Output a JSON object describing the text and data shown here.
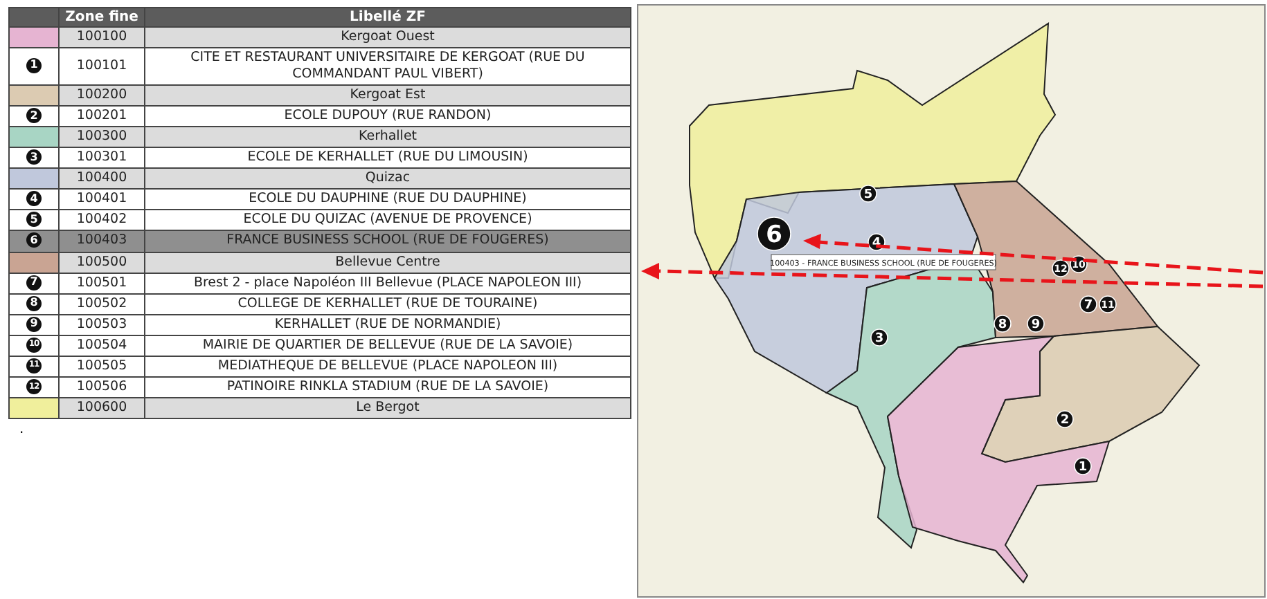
{
  "table": {
    "columns": [
      "Zone fine",
      "Libellé ZF"
    ],
    "rows": [
      {
        "kind": "zone",
        "color": "#e6b4d2",
        "code": "100100",
        "label": "Kergoat Ouest",
        "selected": false
      },
      {
        "kind": "site",
        "marker": "1",
        "code": "100101",
        "label": "CITE ET RESTAURANT UNIVERSITAIRE DE KERGOAT (RUE DU COMMANDANT PAUL VIBERT)",
        "selected": false
      },
      {
        "kind": "zone",
        "color": "#dccbb2",
        "code": "100200",
        "label": "Kergoat Est",
        "selected": false
      },
      {
        "kind": "site",
        "marker": "2",
        "code": "100201",
        "label": "ECOLE DUPOUY (RUE RANDON)",
        "selected": false
      },
      {
        "kind": "zone",
        "color": "#a8d5c4",
        "code": "100300",
        "label": "Kerhallet",
        "selected": false
      },
      {
        "kind": "site",
        "marker": "3",
        "code": "100301",
        "label": "ECOLE DE KERHALLET (RUE DU LIMOUSIN)",
        "selected": false
      },
      {
        "kind": "zone",
        "color": "#c0c8dc",
        "code": "100400",
        "label": "Quizac",
        "selected": false
      },
      {
        "kind": "site",
        "marker": "4",
        "code": "100401",
        "label": "ECOLE DU DAUPHINE (RUE DU DAUPHINE)",
        "selected": false
      },
      {
        "kind": "site",
        "marker": "5",
        "code": "100402",
        "label": "ECOLE DU QUIZAC (AVENUE DE PROVENCE)",
        "selected": false
      },
      {
        "kind": "site",
        "marker": "6",
        "code": "100403",
        "label": "FRANCE BUSINESS SCHOOL (RUE DE FOUGERES)",
        "selected": true
      },
      {
        "kind": "zone",
        "color": "#c9a493",
        "code": "100500",
        "label": "Bellevue Centre",
        "selected": false
      },
      {
        "kind": "site",
        "marker": "7",
        "code": "100501",
        "label": "Brest 2 - place Napoléon III Bellevue (PLACE NAPOLEON III)",
        "selected": false
      },
      {
        "kind": "site",
        "marker": "8",
        "code": "100502",
        "label": "COLLEGE DE KERHALLET (RUE DE TOURAINE)",
        "selected": false
      },
      {
        "kind": "site",
        "marker": "9",
        "code": "100503",
        "label": "KERHALLET (RUE DE NORMANDIE)",
        "selected": false
      },
      {
        "kind": "site",
        "marker": "10",
        "code": "100504",
        "label": "MAIRIE DE QUARTIER DE BELLEVUE (RUE DE LA SAVOIE)",
        "selected": false
      },
      {
        "kind": "site",
        "marker": "11",
        "code": "100505",
        "label": "MEDIATHEQUE DE BELLEVUE (PLACE NAPOLEON III)",
        "selected": false
      },
      {
        "kind": "site",
        "marker": "12",
        "code": "100506",
        "label": "PATINOIRE RINKLA STADIUM (RUE DE LA SAVOIE)",
        "selected": false
      },
      {
        "kind": "zone",
        "color": "#f0ef9c",
        "code": "100600",
        "label": "Le Bergot",
        "selected": false
      }
    ]
  },
  "note": ".",
  "map": {
    "markers": [
      {
        "label": "1",
        "selected": false
      },
      {
        "label": "2",
        "selected": false
      },
      {
        "label": "3",
        "selected": false
      },
      {
        "label": "4",
        "selected": false
      },
      {
        "label": "5",
        "selected": false
      },
      {
        "label": "6",
        "selected": true
      },
      {
        "label": "7",
        "selected": false
      },
      {
        "label": "8",
        "selected": false
      },
      {
        "label": "9",
        "selected": false
      },
      {
        "label": "10",
        "selected": false
      },
      {
        "label": "11",
        "selected": false
      },
      {
        "label": "12",
        "selected": false
      }
    ],
    "tooltip": "100403 - FRANCE BUSINESS SCHOOL (RUE DE FOUGERES)"
  }
}
